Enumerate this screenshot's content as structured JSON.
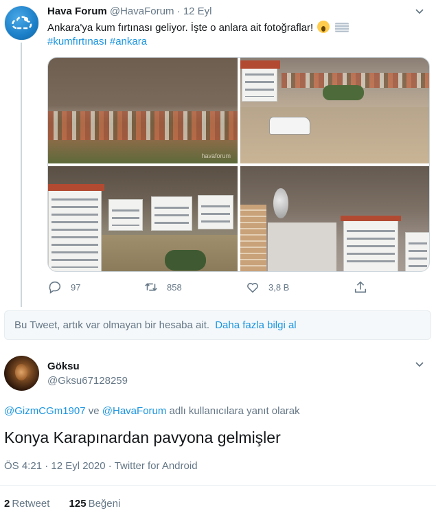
{
  "tweet": {
    "author_name": "Hava Forum",
    "author_handle": "@HavaForum",
    "separator": "·",
    "date": "12 Eyl",
    "text": "Ankara'ya kum fırtınası geliyor. İşte o anlara ait fotoğraflar!",
    "emojis": [
      "face-screaming-in-fear",
      "fog"
    ],
    "hashtags": [
      "#kumfırtınası",
      "#ankara"
    ],
    "watermark": "havaforum",
    "actions": {
      "reply_count": "97",
      "retweet_count": "858",
      "like_count": "3,8 B"
    }
  },
  "notice": {
    "text": "Bu Tweet, artık var olmayan bir hesaba ait.",
    "link": "Daha fazla bilgi al"
  },
  "reply": {
    "author_name": "Göksu",
    "author_handle": "@Gksu67128259",
    "replying_mention_1": "@GizmCGm1907",
    "replying_joiner": "ve",
    "replying_mention_2": "@HavaForum",
    "replying_suffix": "adlı kullanıcılara yanıt olarak",
    "text": "Konya Karapınardan pavyona gelmişler",
    "meta": "ÖS 4:21 · 12 Eyl 2020 · Twitter for Android",
    "retweets": "2",
    "retweets_label": "Retweet",
    "likes": "125",
    "likes_label": "Beğeni"
  },
  "colors": {
    "link": "#1b95e0",
    "secondary_text": "#657786",
    "primary_text": "#14171a",
    "border": "#e6ecf0"
  }
}
